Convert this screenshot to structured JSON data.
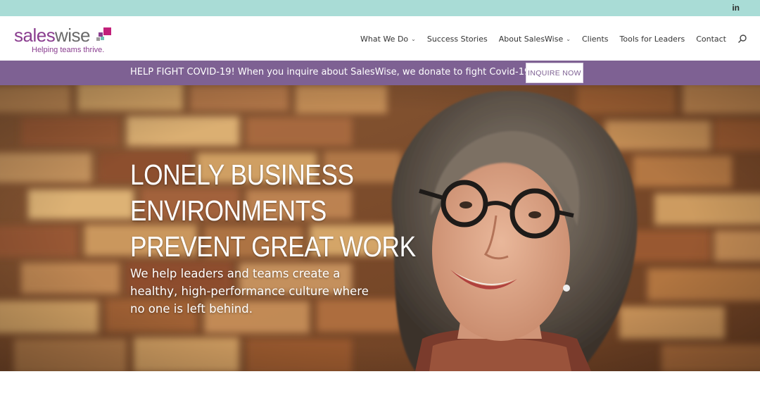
{
  "topbar": {
    "social_icon": "linkedin-icon",
    "social_text": "in"
  },
  "brand": {
    "name_part1": "sales",
    "name_part2": "wise",
    "tagline": "Helping teams thrive.",
    "colors": {
      "purple": "#8a3d8f",
      "magenta": "#c2207a",
      "gray": "#6a6a6a",
      "teal": "#6cc2b4"
    }
  },
  "nav": {
    "items": [
      {
        "label": "What We Do",
        "dropdown": true
      },
      {
        "label": "Success Stories",
        "dropdown": false
      },
      {
        "label": "About SalesWise",
        "dropdown": true
      },
      {
        "label": "Clients",
        "dropdown": false
      },
      {
        "label": "Tools for Leaders",
        "dropdown": false
      },
      {
        "label": "Contact",
        "dropdown": false
      }
    ],
    "search_icon": "search-icon"
  },
  "banner": {
    "message": "HELP FIGHT COVID-19! When you inquire about SalesWise, we donate to fight Covid-19.",
    "button_label": "INQUIRE NOW",
    "color": "#7e6193"
  },
  "hero": {
    "headline": [
      "LONELY BUSINESS",
      "ENVIRONMENTS",
      "PREVENT GREAT WORK"
    ],
    "subtext": "We help leaders and teams create a healthy, high-performance culture where no one is left behind."
  },
  "colors": {
    "topbar": "#a9dcd6",
    "banner": "#7e6193"
  }
}
